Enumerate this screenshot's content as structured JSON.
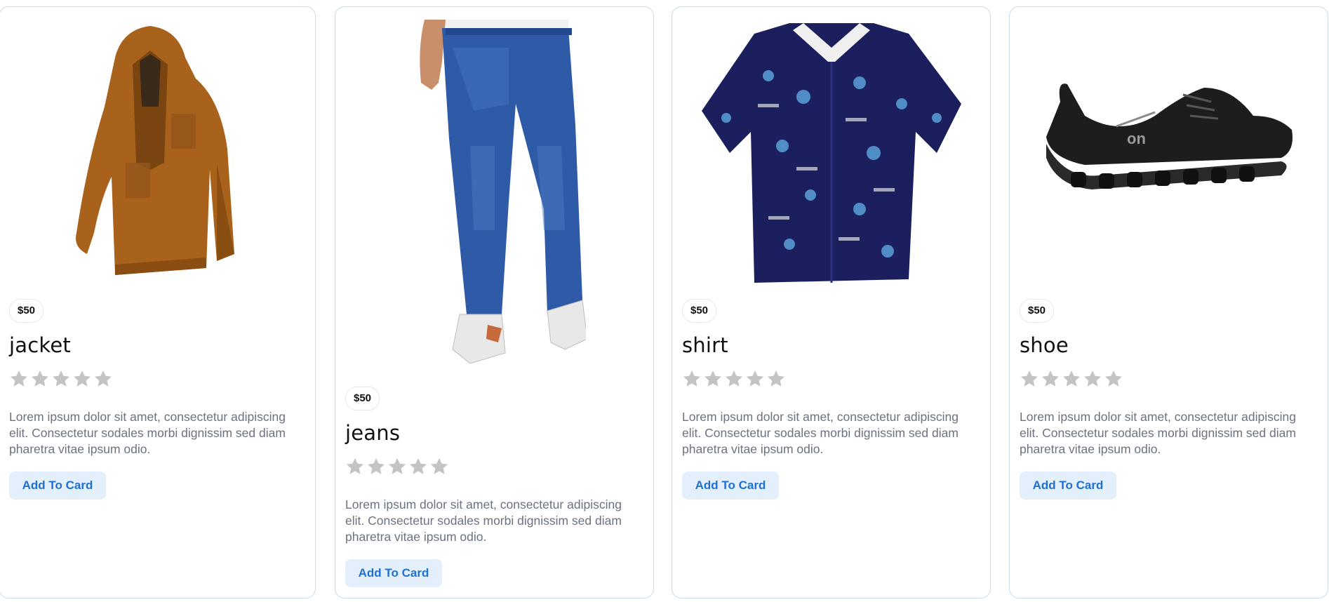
{
  "products": [
    {
      "name": "jacket",
      "price": "$50",
      "rating": 0,
      "description": "Lorem ipsum dolor sit amet, consectetur adipiscing elit. Consectetur sodales morbi dignissim sed diam pharetra vitae ipsum odio.",
      "button_label": "Add To Card",
      "image": "jacket-image"
    },
    {
      "name": "jeans",
      "price": "$50",
      "rating": 0,
      "description": "Lorem ipsum dolor sit amet, consectetur adipiscing elit. Consectetur sodales morbi dignissim sed diam pharetra vitae ipsum odio.",
      "button_label": "Add To Card",
      "image": "jeans-image"
    },
    {
      "name": "shirt",
      "price": "$50",
      "rating": 0,
      "description": "Lorem ipsum dolor sit amet, consectetur adipiscing elit. Consectetur sodales morbi dignissim sed diam pharetra vitae ipsum odio.",
      "button_label": "Add To Card",
      "image": "shirt-image"
    },
    {
      "name": "shoe",
      "price": "$50",
      "rating": 0,
      "description": "Lorem ipsum dolor sit amet, consectetur adipiscing elit. Consectetur sodales morbi dignissim sed diam pharetra vitae ipsum odio.",
      "button_label": "Add To Card",
      "image": "shoe-image"
    }
  ],
  "colors": {
    "star_inactive": "#c4c4c4",
    "button_bg": "#e3f0fb",
    "button_text": "#1f6fd1",
    "card_border": "#c8dbe6",
    "description_text": "#6b7280"
  }
}
